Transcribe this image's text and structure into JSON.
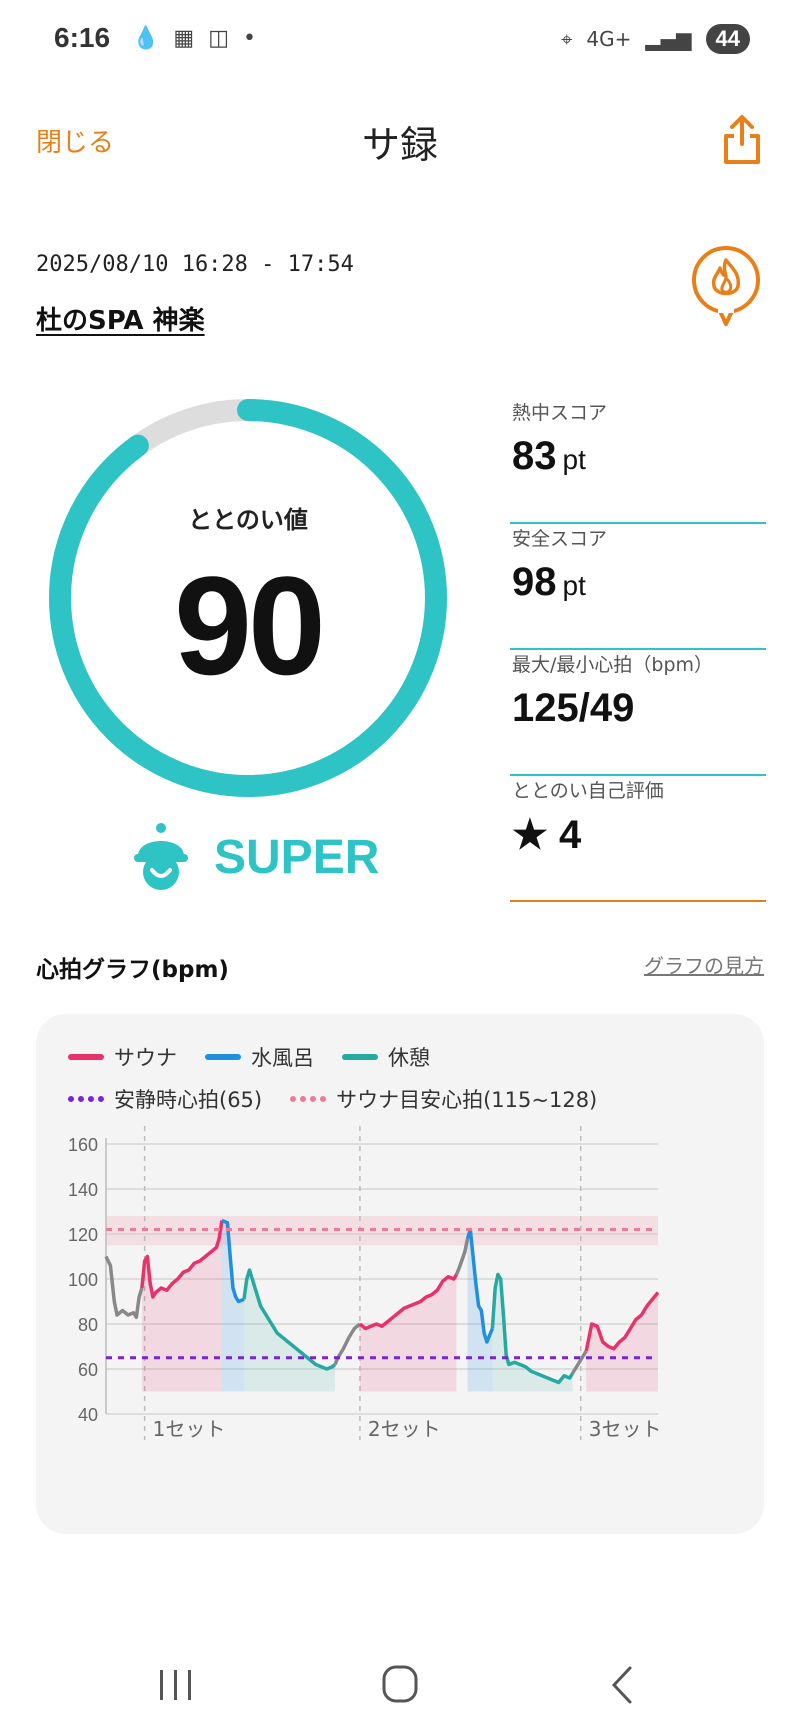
{
  "status": {
    "time": "6:16",
    "battery": "44",
    "network": "4G+"
  },
  "header": {
    "close_label": "閉じる",
    "title": "サ録"
  },
  "session": {
    "datetime": "2025/08/10 16:28 - 17:54",
    "place": "杜のSPA 神楽"
  },
  "gauge": {
    "label": "ととのい値",
    "value": "90",
    "percent": 90,
    "rank": "SUPER",
    "color": "#2ec4c6",
    "track_color": "#dddddd"
  },
  "scores": [
    {
      "label": "熱中スコア",
      "value": "83",
      "unit": "pt"
    },
    {
      "label": "安全スコア",
      "value": "98",
      "unit": "pt"
    },
    {
      "label": "最大/最小心拍（bpm）",
      "value": "125/49",
      "unit": ""
    },
    {
      "label": "ととのい自己評価",
      "value": "★ 4",
      "unit": ""
    }
  ],
  "graph": {
    "title": "心拍グラフ(bpm)",
    "help_link": "グラフの見方"
  },
  "colors": {
    "accent": "#e8801a",
    "sauna": "#e8336a",
    "water": "#1f8fe0",
    "rest": "#26a9a0",
    "idle": "#888888",
    "resting_hr": "#7a22d6",
    "target_hr": "#f07a95"
  },
  "chart_data": {
    "type": "line",
    "title": "",
    "xlabel": "",
    "ylabel": "",
    "ylim": [
      40,
      160
    ],
    "yticks": [
      40,
      60,
      80,
      100,
      120,
      140,
      160
    ],
    "legend": [
      {
        "name": "サウナ",
        "style": "solid",
        "color": "#e8336a"
      },
      {
        "name": "水風呂",
        "style": "solid",
        "color": "#1f8fe0"
      },
      {
        "name": "休憩",
        "style": "solid",
        "color": "#26a9a0"
      },
      {
        "name": "安静時心拍(65)",
        "style": "dotted",
        "color": "#7a22d6"
      },
      {
        "name": "サウナ目安心拍(115~128)",
        "style": "dotted",
        "color": "#f07a95"
      }
    ],
    "x_markers": [
      {
        "label": "1セット",
        "t": 7
      },
      {
        "label": "2セット",
        "t": 46
      },
      {
        "label": "3セット",
        "t": 86
      }
    ],
    "resting_hr": 65,
    "target_band": [
      115,
      128
    ],
    "target_line": 122,
    "t_range": [
      0,
      100
    ],
    "series": [
      {
        "name": "",
        "phase": "idle",
        "points": [
          [
            0,
            110
          ],
          [
            0.8,
            106
          ],
          [
            1.5,
            90
          ],
          [
            2,
            84
          ],
          [
            3,
            86
          ],
          [
            4,
            84
          ],
          [
            5,
            85
          ],
          [
            5.5,
            83
          ],
          [
            6,
            92
          ],
          [
            6.5,
            96
          ]
        ]
      },
      {
        "name": "サウナ",
        "phase": "sauna",
        "points": [
          [
            6.5,
            96
          ],
          [
            7,
            108
          ],
          [
            7.5,
            110
          ],
          [
            8,
            98
          ],
          [
            8.5,
            92
          ],
          [
            9,
            94
          ],
          [
            10,
            96
          ],
          [
            11,
            95
          ],
          [
            12,
            98
          ],
          [
            13,
            100
          ],
          [
            14,
            103
          ],
          [
            15,
            104
          ],
          [
            16,
            107
          ],
          [
            17,
            108
          ],
          [
            18,
            110
          ],
          [
            19,
            112
          ],
          [
            20,
            114
          ],
          [
            20.5,
            118
          ],
          [
            21,
            126
          ]
        ]
      },
      {
        "name": "水風呂",
        "phase": "water",
        "points": [
          [
            21,
            126
          ],
          [
            22,
            125
          ],
          [
            22.5,
            110
          ],
          [
            23,
            96
          ],
          [
            23.5,
            92
          ],
          [
            24,
            90
          ],
          [
            25,
            91
          ]
        ]
      },
      {
        "name": "休憩",
        "phase": "rest",
        "points": [
          [
            25,
            91
          ],
          [
            25.5,
            100
          ],
          [
            26,
            104
          ],
          [
            27,
            96
          ],
          [
            28,
            88
          ],
          [
            29,
            84
          ],
          [
            30,
            80
          ],
          [
            31,
            76
          ],
          [
            32,
            74
          ],
          [
            33,
            72
          ],
          [
            34,
            70
          ],
          [
            35,
            68
          ],
          [
            36,
            66
          ],
          [
            37,
            64
          ],
          [
            38,
            62
          ],
          [
            39,
            61
          ],
          [
            40,
            60
          ],
          [
            41,
            61
          ],
          [
            41.5,
            62
          ]
        ]
      },
      {
        "name": "",
        "phase": "idle",
        "points": [
          [
            41.5,
            62
          ],
          [
            42,
            65
          ],
          [
            43,
            69
          ],
          [
            44,
            74
          ],
          [
            45,
            78
          ],
          [
            46,
            80
          ]
        ]
      },
      {
        "name": "サウナ",
        "phase": "sauna",
        "points": [
          [
            46,
            80
          ],
          [
            47,
            78
          ],
          [
            48,
            79
          ],
          [
            49,
            80
          ],
          [
            50,
            79
          ],
          [
            51,
            81
          ],
          [
            52,
            83
          ],
          [
            53,
            85
          ],
          [
            54,
            87
          ],
          [
            55,
            88
          ],
          [
            56,
            89
          ],
          [
            57,
            90
          ],
          [
            58,
            92
          ],
          [
            59,
            93
          ],
          [
            60,
            95
          ],
          [
            61,
            99
          ],
          [
            62,
            101
          ],
          [
            63,
            100
          ],
          [
            63.5,
            102
          ]
        ]
      },
      {
        "name": "",
        "phase": "idle",
        "points": [
          [
            63.5,
            102
          ],
          [
            64,
            105
          ],
          [
            65,
            112
          ],
          [
            65.5,
            118
          ]
        ]
      },
      {
        "name": "水風呂",
        "phase": "water",
        "points": [
          [
            65.5,
            118
          ],
          [
            66,
            122
          ],
          [
            67,
            98
          ],
          [
            67.5,
            88
          ],
          [
            68,
            86
          ],
          [
            68.5,
            76
          ],
          [
            69,
            72
          ],
          [
            70,
            78
          ]
        ]
      },
      {
        "name": "休憩",
        "phase": "rest",
        "points": [
          [
            70,
            78
          ],
          [
            70.5,
            96
          ],
          [
            71,
            102
          ],
          [
            71.5,
            100
          ],
          [
            72,
            84
          ],
          [
            72.5,
            66
          ],
          [
            73,
            62
          ],
          [
            74,
            63
          ],
          [
            75,
            62
          ],
          [
            76,
            61
          ],
          [
            77,
            59
          ],
          [
            78,
            58
          ],
          [
            79,
            57
          ],
          [
            80,
            56
          ],
          [
            81,
            55
          ],
          [
            82,
            54
          ],
          [
            83,
            57
          ],
          [
            84,
            56
          ],
          [
            84.5,
            58
          ]
        ]
      },
      {
        "name": "",
        "phase": "idle",
        "points": [
          [
            84.5,
            58
          ],
          [
            85,
            60
          ],
          [
            86,
            64
          ],
          [
            87,
            68
          ]
        ]
      },
      {
        "name": "サウナ",
        "phase": "sauna",
        "points": [
          [
            87,
            68
          ],
          [
            88,
            80
          ],
          [
            89,
            79
          ],
          [
            90,
            72
          ],
          [
            91,
            70
          ],
          [
            92,
            69
          ],
          [
            93,
            72
          ],
          [
            94,
            74
          ],
          [
            95,
            78
          ],
          [
            96,
            82
          ],
          [
            97,
            84
          ],
          [
            98,
            88
          ],
          [
            99,
            91
          ],
          [
            100,
            94
          ]
        ]
      }
    ]
  }
}
